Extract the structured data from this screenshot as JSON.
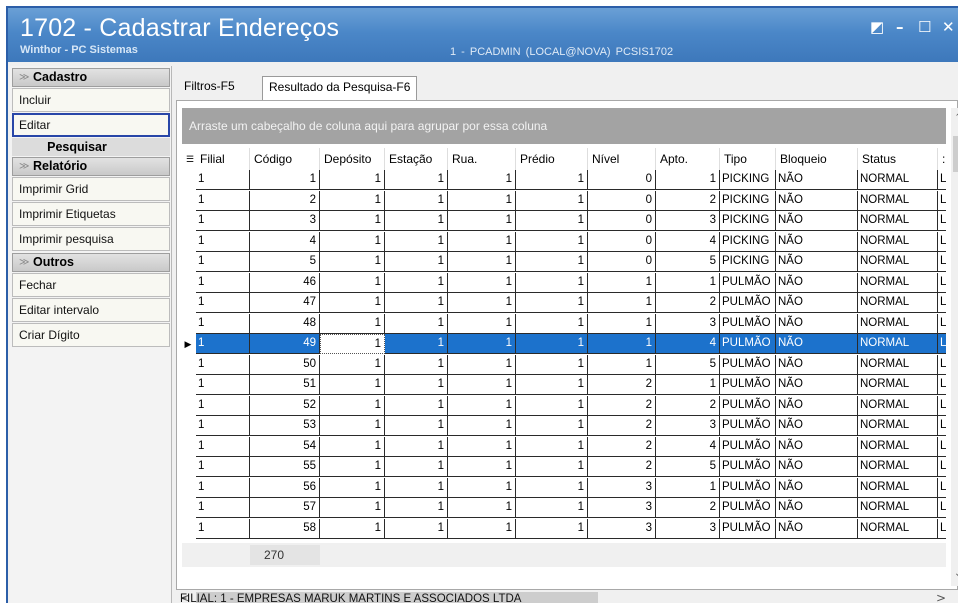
{
  "window": {
    "title": "1702 - Cadastrar Endereços",
    "subtitle": "Winthor - PC Sistemas",
    "session": "1 - PCADMIN (LOCAL@NOVA)   PCSIS1702",
    "controls": [
      "restore-icon",
      "minimize-icon",
      "maximize-icon",
      "close-icon"
    ]
  },
  "sidebar": {
    "cadastro": {
      "label": "Cadastro",
      "items": [
        "Incluir",
        "Editar"
      ]
    },
    "pesquisar": "Pesquisar",
    "relatorio": {
      "label": "Relatório",
      "items": [
        "Imprimir Grid",
        "Imprimir Etiquetas",
        "Imprimir pesquisa"
      ]
    },
    "outros": {
      "label": "Outros",
      "items": [
        "Fechar",
        "Editar intervalo",
        "Criar Dígito"
      ]
    },
    "active_item": "Editar"
  },
  "tabs": [
    {
      "label": "Filtros-F5",
      "active": false
    },
    {
      "label": "Resultado da Pesquisa-F6",
      "active": true
    }
  ],
  "grid": {
    "group_hint": "Arraste um cabeçalho de coluna aqui para agrupar por essa coluna",
    "columns": [
      "Filial",
      "Código",
      "Depósito",
      "Estação",
      "Rua.",
      "Prédio",
      "Nível",
      "Apto.",
      "Tipo",
      "Bloqueio",
      "Status"
    ],
    "rows": [
      [
        "1",
        "1",
        "1",
        "1",
        "1",
        "1",
        "0",
        "1",
        "PICKING",
        "NÃO",
        "NORMAL"
      ],
      [
        "1",
        "2",
        "1",
        "1",
        "1",
        "1",
        "0",
        "2",
        "PICKING",
        "NÃO",
        "NORMAL"
      ],
      [
        "1",
        "3",
        "1",
        "1",
        "1",
        "1",
        "0",
        "3",
        "PICKING",
        "NÃO",
        "NORMAL"
      ],
      [
        "1",
        "4",
        "1",
        "1",
        "1",
        "1",
        "0",
        "4",
        "PICKING",
        "NÃO",
        "NORMAL"
      ],
      [
        "1",
        "5",
        "1",
        "1",
        "1",
        "1",
        "0",
        "5",
        "PICKING",
        "NÃO",
        "NORMAL"
      ],
      [
        "1",
        "46",
        "1",
        "1",
        "1",
        "1",
        "1",
        "1",
        "PULMÃO",
        "NÃO",
        "NORMAL"
      ],
      [
        "1",
        "47",
        "1",
        "1",
        "1",
        "1",
        "1",
        "2",
        "PULMÃO",
        "NÃO",
        "NORMAL"
      ],
      [
        "1",
        "48",
        "1",
        "1",
        "1",
        "1",
        "1",
        "3",
        "PULMÃO",
        "NÃO",
        "NORMAL"
      ],
      [
        "1",
        "49",
        "1",
        "1",
        "1",
        "1",
        "1",
        "4",
        "PULMÃO",
        "NÃO",
        "NORMAL"
      ],
      [
        "1",
        "50",
        "1",
        "1",
        "1",
        "1",
        "1",
        "5",
        "PULMÃO",
        "NÃO",
        "NORMAL"
      ],
      [
        "1",
        "51",
        "1",
        "1",
        "1",
        "1",
        "2",
        "1",
        "PULMÃO",
        "NÃO",
        "NORMAL"
      ],
      [
        "1",
        "52",
        "1",
        "1",
        "1",
        "1",
        "2",
        "2",
        "PULMÃO",
        "NÃO",
        "NORMAL"
      ],
      [
        "1",
        "53",
        "1",
        "1",
        "1",
        "1",
        "2",
        "3",
        "PULMÃO",
        "NÃO",
        "NORMAL"
      ],
      [
        "1",
        "54",
        "1",
        "1",
        "1",
        "1",
        "2",
        "4",
        "PULMÃO",
        "NÃO",
        "NORMAL"
      ],
      [
        "1",
        "55",
        "1",
        "1",
        "1",
        "1",
        "2",
        "5",
        "PULMÃO",
        "NÃO",
        "NORMAL"
      ],
      [
        "1",
        "56",
        "1",
        "1",
        "1",
        "1",
        "3",
        "1",
        "PULMÃO",
        "NÃO",
        "NORMAL"
      ],
      [
        "1",
        "57",
        "1",
        "1",
        "1",
        "1",
        "3",
        "2",
        "PULMÃO",
        "NÃO",
        "NORMAL"
      ],
      [
        "1",
        "58",
        "1",
        "1",
        "1",
        "1",
        "3",
        "3",
        "PULMÃO",
        "NÃO",
        "NORMAL"
      ]
    ],
    "selected_row": 8,
    "footer_count": "270"
  },
  "status_text": "FILIAL: 1 - EMPRESAS MARUK MARTINS E ASSOCIADOS LTDA",
  "colors": {
    "titlebar": "#4b87c8",
    "selection": "#1c72cc",
    "active_border": "#2846a8"
  }
}
